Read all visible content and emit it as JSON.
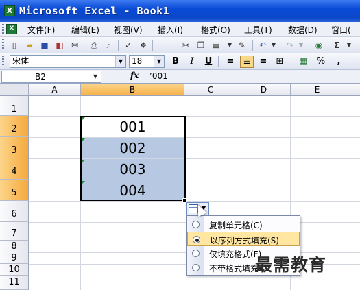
{
  "window": {
    "title": "Microsoft Excel - Book1"
  },
  "menu": [
    "文件(F)",
    "编辑(E)",
    "视图(V)",
    "插入(I)",
    "格式(O)",
    "工具(T)",
    "数据(D)",
    "窗口("
  ],
  "format_toolbar": {
    "font": "宋体",
    "size": "18",
    "bold": "B",
    "italic": "I",
    "underline": "U",
    "comma": ",",
    "percent": "%"
  },
  "formula_bar": {
    "name_box": "B2",
    "fx": "fx",
    "formula": "’001"
  },
  "columns": [
    "A",
    "B",
    "C",
    "D",
    "E"
  ],
  "selected_column": "B",
  "rows": [
    "1",
    "2",
    "3",
    "4",
    "5",
    "6",
    "7",
    "8",
    "9",
    "10",
    "11"
  ],
  "selected_rows": [
    "2",
    "3",
    "4",
    "5"
  ],
  "cells": [
    {
      "ref": "B2",
      "value": "001"
    },
    {
      "ref": "B3",
      "value": "002"
    },
    {
      "ref": "B4",
      "value": "003"
    },
    {
      "ref": "B5",
      "value": "004"
    }
  ],
  "autofill_options": {
    "selected": "以序列方式填充(S)",
    "items": [
      "复制单元格(C)",
      "以序列方式填充(S)",
      "仅填充格式(F)",
      "不带格式填充"
    ]
  },
  "watermark": "最需教育",
  "colors": {
    "title_bar": "#0a4bd6",
    "selection_fill": "#b7c9e2",
    "header_selected": "#f5b24a",
    "menu_highlight": "#ffe7a2"
  }
}
